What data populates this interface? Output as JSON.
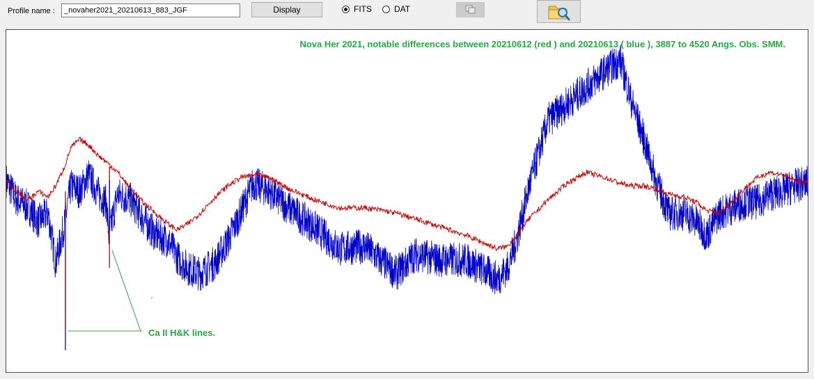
{
  "toolbar": {
    "profile_label": "Profile name :",
    "profile_value": "_novaher2021_20210613_883_JGF",
    "display_label": "Display",
    "radio_fits": "FITS",
    "radio_dat": "DAT",
    "selected_format": "FITS"
  },
  "plot": {
    "title": "Nova Her 2021, notable differences between 20210612 (red ) and 20210613 ( blue ), 3887 to 4520 Angs. Obs. SMM.",
    "annotation": "Ca II H&K lines."
  },
  "chart_data": {
    "type": "line",
    "xlim": [
      3887,
      4520
    ],
    "series": [
      {
        "color": "#0000cc",
        "x": [
          3887,
          3895,
          3905,
          3912,
          3920,
          3926,
          3933,
          3938,
          3945,
          3952,
          3960,
          3966,
          3968,
          3975,
          3985,
          3995,
          4005,
          4015,
          4022,
          4030,
          4040,
          4052,
          4062,
          4072,
          4082,
          4095,
          4110,
          4130,
          4150,
          4170,
          4185,
          4195,
          4210,
          4230,
          4250,
          4265,
          4275,
          4283,
          4290,
          4300,
          4315,
          4330,
          4345,
          4360,
          4372,
          4380,
          4390,
          4400,
          4410,
          4422,
          4432,
          4440,
          4450,
          4460,
          4470,
          4480,
          4490,
          4500,
          4510,
          4520
        ],
        "y": [
          0.8,
          0.73,
          0.7,
          0.65,
          0.68,
          0.5,
          0.64,
          0.78,
          0.76,
          0.82,
          0.75,
          0.72,
          0.6,
          0.75,
          0.73,
          0.66,
          0.6,
          0.58,
          0.52,
          0.48,
          0.46,
          0.5,
          0.58,
          0.68,
          0.79,
          0.76,
          0.7,
          0.63,
          0.55,
          0.56,
          0.5,
          0.46,
          0.53,
          0.51,
          0.51,
          0.47,
          0.44,
          0.48,
          0.58,
          0.78,
          1.02,
          1.08,
          1.14,
          1.2,
          1.24,
          1.1,
          0.96,
          0.8,
          0.68,
          0.68,
          0.65,
          0.6,
          0.68,
          0.7,
          0.72,
          0.72,
          0.75,
          0.76,
          0.78,
          0.79
        ]
      },
      {
        "color": "#cc0000",
        "x": [
          3887,
          3895,
          3905,
          3912,
          3920,
          3926,
          3933,
          3938,
          3945,
          3952,
          3960,
          3968,
          3975,
          3985,
          3995,
          4005,
          4015,
          4022,
          4030,
          4040,
          4052,
          4062,
          4072,
          4082,
          4095,
          4110,
          4130,
          4150,
          4170,
          4185,
          4195,
          4210,
          4230,
          4250,
          4265,
          4275,
          4283,
          4290,
          4300,
          4315,
          4330,
          4345,
          4360,
          4372,
          4380,
          4390,
          4400,
          4410,
          4422,
          4432,
          4440,
          4450,
          4460,
          4470,
          4480,
          4490,
          4500,
          4510,
          4520
        ],
        "y": [
          0.8,
          0.76,
          0.73,
          0.76,
          0.74,
          0.78,
          0.85,
          0.92,
          0.95,
          0.93,
          0.89,
          0.86,
          0.83,
          0.77,
          0.72,
          0.68,
          0.64,
          0.62,
          0.64,
          0.68,
          0.74,
          0.78,
          0.81,
          0.82,
          0.81,
          0.77,
          0.73,
          0.7,
          0.7,
          0.69,
          0.68,
          0.66,
          0.63,
          0.6,
          0.57,
          0.55,
          0.56,
          0.6,
          0.66,
          0.73,
          0.79,
          0.83,
          0.81,
          0.79,
          0.78,
          0.78,
          0.77,
          0.75,
          0.74,
          0.72,
          0.69,
          0.68,
          0.72,
          0.77,
          0.81,
          0.83,
          0.82,
          0.8,
          0.79
        ]
      }
    ]
  }
}
